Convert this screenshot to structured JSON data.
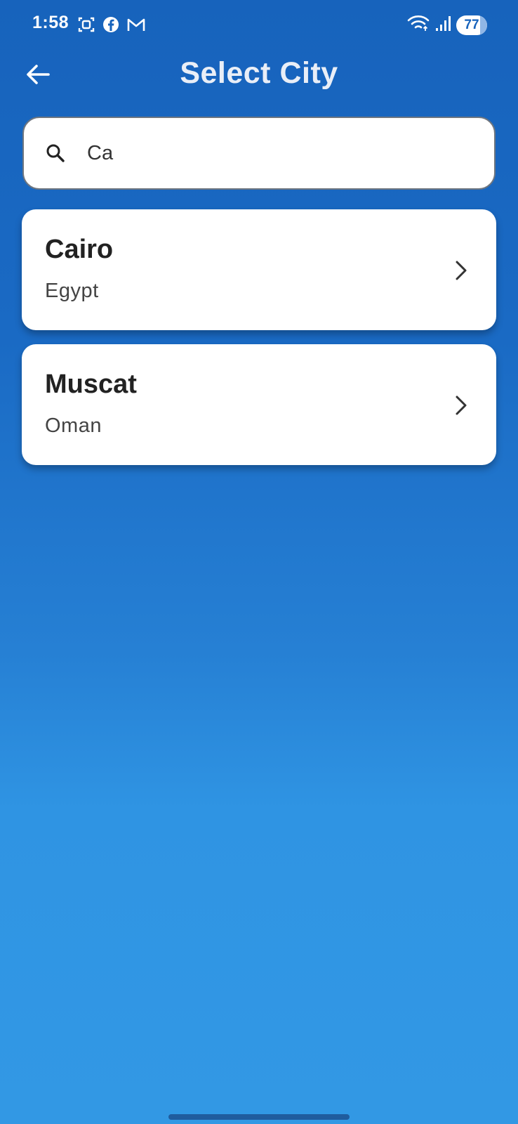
{
  "status_bar": {
    "time": "1:58",
    "battery_level": "77",
    "battery_fraction": 0.77,
    "left_icons": [
      "screenshot-icon",
      "facebook-icon",
      "gmail-icon"
    ],
    "right_icons": [
      "wifi-icon",
      "signal-icon",
      "battery-icon"
    ]
  },
  "header": {
    "title": "Select City",
    "back_icon": "arrow-left-icon"
  },
  "search": {
    "value": "Ca",
    "icon": "search-icon"
  },
  "results": [
    {
      "city": "Cairo",
      "country": "Egypt"
    },
    {
      "city": "Muscat",
      "country": "Oman"
    }
  ],
  "colors": {
    "gradient_top": "#1763bc",
    "gradient_bottom": "#3298e4",
    "card_background": "#ffffff",
    "title_text": "#e9eef7"
  }
}
